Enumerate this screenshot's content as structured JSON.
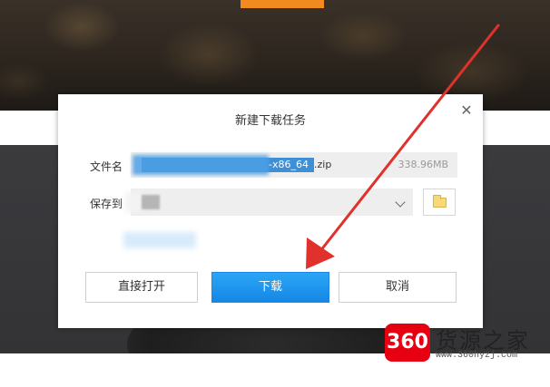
{
  "background": {
    "accent_color": "#f18a1f"
  },
  "dialog": {
    "title": "新建下载任务",
    "close_icon": "close-icon",
    "filename_label": "文件名",
    "filename_visible": "-x86_64",
    "filename_ext": ".zip",
    "filesize": "338.96MB",
    "saveto_label": "保存到",
    "open_button_label": "直接打开",
    "download_button_label": "下载",
    "cancel_button_label": "取消",
    "primary_color": "#1a8fe8"
  },
  "watermark": {
    "logo_text": "360",
    "title": "货源之家",
    "url": "www.360hyzj.com",
    "logo_color": "#e60012"
  },
  "annotation": {
    "arrow_color": "#e0312c"
  }
}
